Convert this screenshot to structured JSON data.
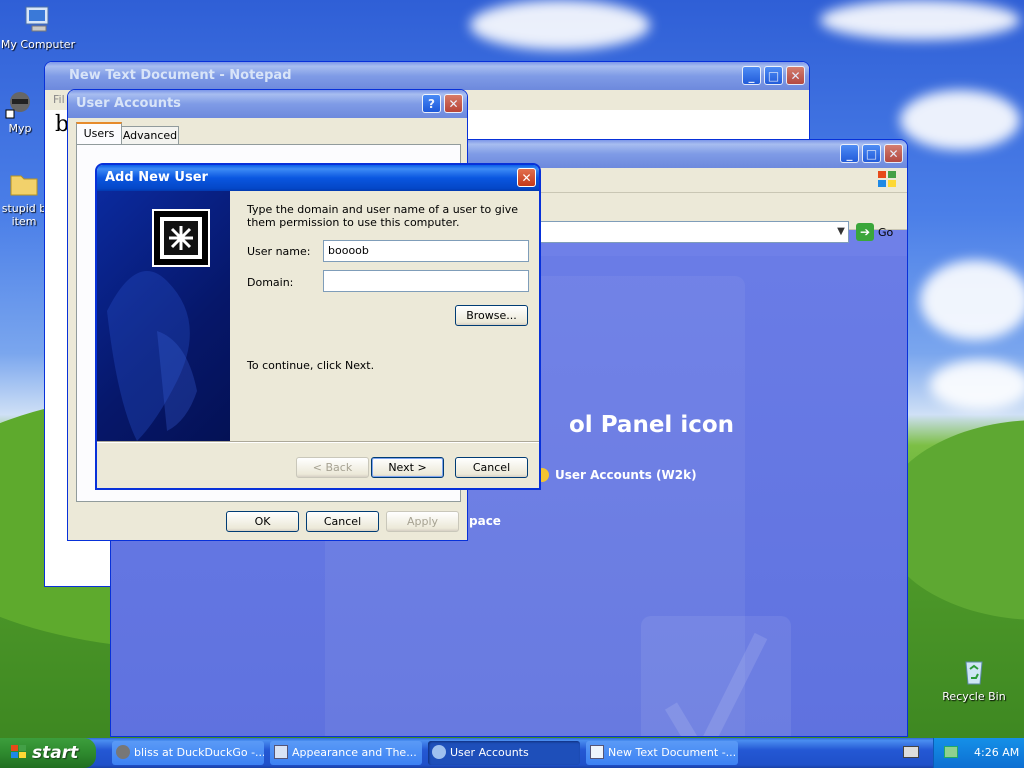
{
  "desktop": {
    "icons": [
      {
        "label": "My Computer"
      },
      {
        "label": "Myp"
      },
      {
        "label": "stupid b item"
      },
      {
        "label": "Recycle Bin"
      }
    ]
  },
  "notepad": {
    "title": "New Text Document - Notepad",
    "menu_first": "Fil",
    "content_letter": "b"
  },
  "control_panel": {
    "heading_fragment": "ol Panel icon",
    "link_user_accounts": "User Accounts (W2k)",
    "link_space": "pace",
    "go_label": "Go"
  },
  "user_accounts": {
    "title": "User Accounts",
    "tabs": [
      "Users",
      "Advanced"
    ],
    "ok": "OK",
    "cancel": "Cancel",
    "apply": "Apply"
  },
  "add_user": {
    "title": "Add New User",
    "description": "Type the domain and user name of a user to give them permission to use this computer.",
    "username_label": "User name:",
    "username_value": "boooob",
    "domain_label": "Domain:",
    "domain_value": "",
    "browse": "Browse...",
    "continue_text": "To continue, click Next.",
    "back": "< Back",
    "next": "Next >",
    "cancel": "Cancel"
  },
  "taskbar": {
    "start": "start",
    "tasks": [
      {
        "label": "bliss at DuckDuckGo -..."
      },
      {
        "label": "Appearance and The..."
      },
      {
        "label": "User Accounts"
      },
      {
        "label": "New Text Document -..."
      }
    ],
    "clock": "4:26 AM"
  }
}
